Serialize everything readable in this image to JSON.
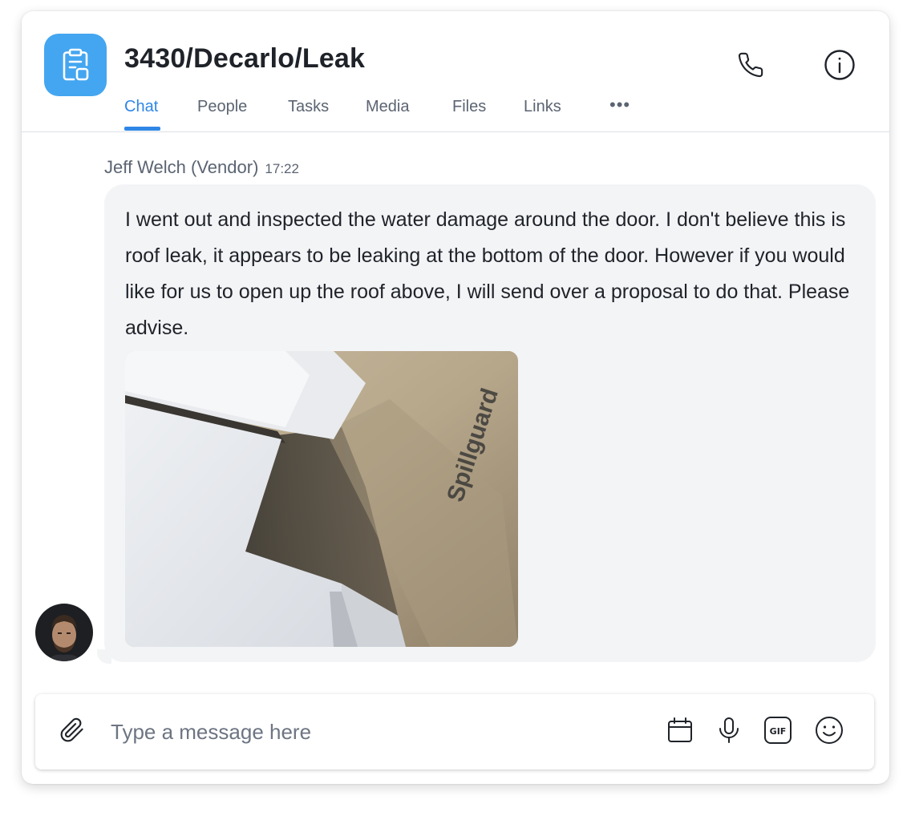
{
  "header": {
    "title": "3430/Decarlo/Leak",
    "icons": {
      "app": "clipboard-icon",
      "call": "phone-icon",
      "info": "info-icon",
      "more": "more-horizontal-icon"
    }
  },
  "tabs": [
    {
      "label": "Chat",
      "active": true
    },
    {
      "label": "People",
      "active": false
    },
    {
      "label": "Tasks",
      "active": false
    },
    {
      "label": "Media",
      "active": false
    },
    {
      "label": "Files",
      "active": false
    },
    {
      "label": "Links",
      "active": false
    }
  ],
  "more_label": "•••",
  "message": {
    "sender": "Jeff Welch (Vendor)",
    "time": "17:22",
    "text": "I went out and inspected the water damage around the door. I don't believe this is roof leak, it appears to be leaking at the bottom of the door. However if you would like for us to open up the roof above, I will send over a proposal to do that. Please advise.",
    "photo_watermark": "Spillguard"
  },
  "composer": {
    "placeholder": "Type a message here",
    "value": "",
    "icons": [
      "paperclip-icon",
      "calendar-icon",
      "microphone-icon",
      "gif-icon",
      "smiley-icon"
    ]
  },
  "colors": {
    "accent": "#2f86e6",
    "app_icon_bg": "#44a6f0",
    "bubble_bg": "#f3f4f6",
    "text": "#1f2329",
    "muted": "#5b6472"
  }
}
